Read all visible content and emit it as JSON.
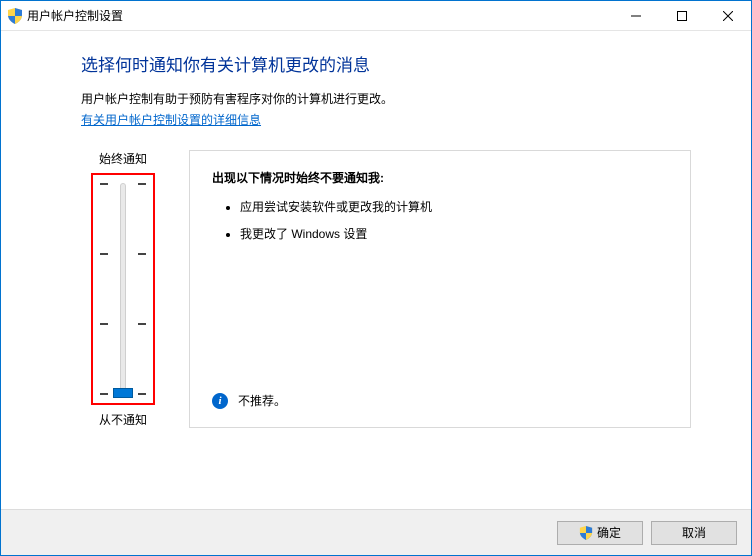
{
  "window": {
    "title": "用户帐户控制设置"
  },
  "content": {
    "heading": "选择何时通知你有关计算机更改的消息",
    "description": "用户帐户控制有助于预防有害程序对你的计算机进行更改。",
    "link": "有关用户帐户控制设置的详细信息"
  },
  "slider": {
    "top_label": "始终通知",
    "bottom_label": "从不通知",
    "levels": 4,
    "current_level": 0
  },
  "panel": {
    "title": "出现以下情况时始终不要通知我:",
    "bullets": [
      "应用尝试安装软件或更改我的计算机",
      "我更改了 Windows 设置"
    ],
    "note": "不推荐。"
  },
  "buttons": {
    "ok": "确定",
    "cancel": "取消"
  },
  "icons": {
    "shield": "shield-icon",
    "info": "info-icon",
    "minimize": "minimize-icon",
    "maximize": "maximize-icon",
    "close": "close-icon"
  }
}
